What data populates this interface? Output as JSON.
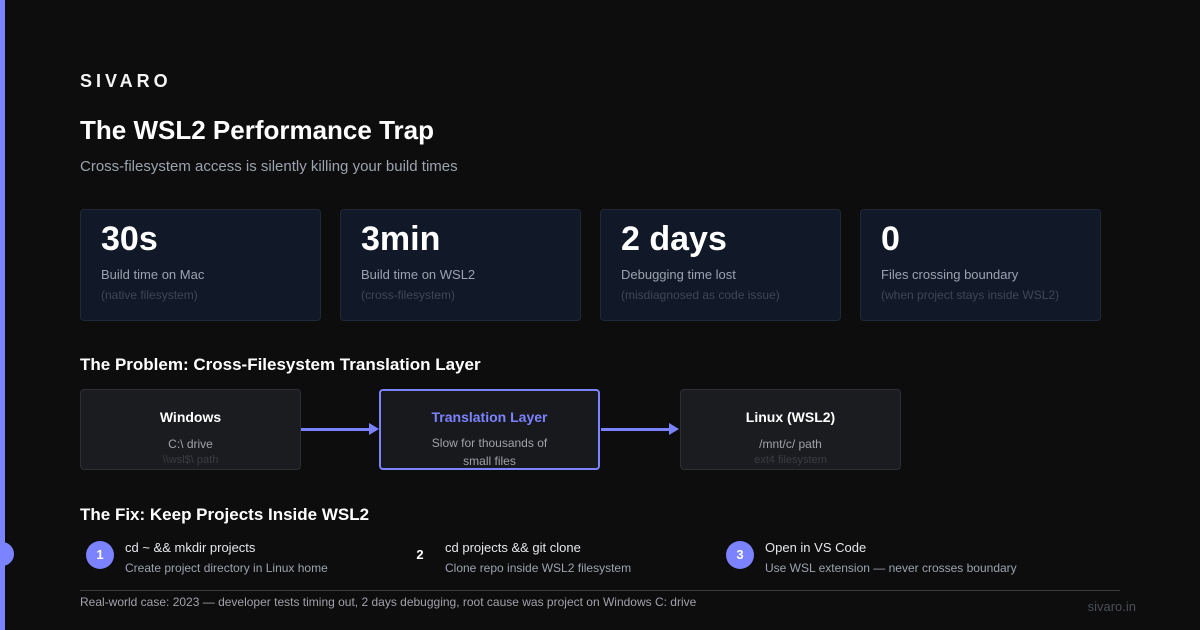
{
  "brand": "SIVARO",
  "title": "The WSL2 Performance Trap",
  "subtitle": "Cross-filesystem access is silently killing your build times",
  "stats": [
    {
      "value": "30s",
      "label": "Build time on Mac",
      "note": "(native filesystem)"
    },
    {
      "value": "3min",
      "label": "Build time on WSL2",
      "note": "(cross-filesystem)"
    },
    {
      "value": "2 days",
      "label": "Debugging time lost",
      "note": "(misdiagnosed as code issue)"
    },
    {
      "value": "0",
      "label": "Files crossing boundary",
      "note": "(when project stays inside WSL2)"
    }
  ],
  "problem": {
    "heading": "The Problem: Cross-Filesystem Translation Layer",
    "boxes": [
      {
        "title": "Windows",
        "sub": "C:\\ drive",
        "note": "\\\\wsl$\\ path"
      },
      {
        "title": "Translation Layer",
        "sub": "Slow for thousands of small files"
      },
      {
        "title": "Linux (WSL2)",
        "sub": "/mnt/c/ path",
        "note": "ext4 filesystem"
      }
    ]
  },
  "fix": {
    "heading": "The Fix: Keep Projects Inside WSL2",
    "steps": [
      {
        "num": "1",
        "cmd": "cd ~ && mkdir projects",
        "desc": "Create project directory in Linux home"
      },
      {
        "num": "2",
        "cmd": "cd projects && git clone",
        "desc": "Clone repo inside WSL2 filesystem"
      },
      {
        "num": "3",
        "cmd": "Open in VS Code",
        "desc": "Use WSL extension — never crosses boundary"
      }
    ]
  },
  "footer": {
    "text": "Real-world case: 2023 — developer tests timing out, 2 days debugging, root cause was project on Windows C: drive",
    "url": "sivaro.in"
  },
  "colors": {
    "accent": "#7c83ff",
    "background": "#0d0d0e",
    "card": "#111827"
  }
}
